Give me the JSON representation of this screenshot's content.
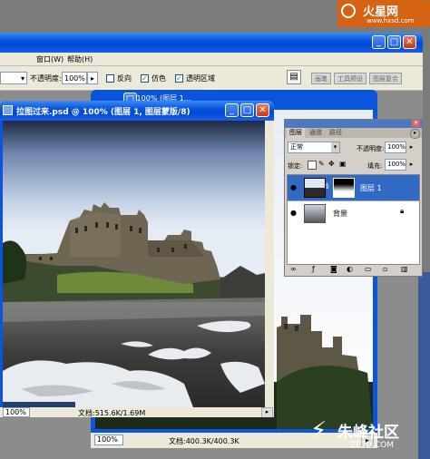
{
  "watermark_top": {
    "main": "火星网",
    "url": "www.hxsd.com"
  },
  "watermark_bottom": {
    "main": "朱峰社区",
    "url": "ZF3D.COM"
  },
  "menubar": {
    "items": [
      "窗口(W)",
      "帮助(H)"
    ]
  },
  "options_bar": {
    "opacity_label": "不透明度:",
    "opacity_value": "100%",
    "reverse_label": "反向",
    "dither_label": "仿色",
    "transparency_label": "透明区域",
    "reverse_checked": false,
    "dither_checked": true,
    "transparency_checked": true
  },
  "palette_well": {
    "tabs": [
      "画笔",
      "工具预设",
      "图层复合"
    ]
  },
  "back_window": {
    "title_fragment": "@ 100% (图层 1...",
    "zoom": "100%",
    "doc_info": "文档:400.3K/400.3K"
  },
  "front_window": {
    "title": "拉图过来.psd @ 100% (图层 1, 图层蒙版/8)",
    "zoom": "100%",
    "doc_info": "文档:515.6K/1.69M"
  },
  "layers_panel": {
    "tabs": [
      "图层",
      "通道",
      "路径"
    ],
    "blend_mode": "正常",
    "opacity_label": "不透明度:",
    "opacity_value": "100%",
    "lock_label": "锁定:",
    "fill_label": "填充:",
    "fill_value": "100%",
    "layers": [
      {
        "name": "图层 1",
        "selected": true,
        "has_mask": true
      },
      {
        "name": "背景",
        "selected": false,
        "locked": true
      }
    ]
  },
  "colors": {
    "xp_blue": "#0a55dc",
    "selected_layer": "#316ac5",
    "panel_bg": "#d4d0c8"
  }
}
